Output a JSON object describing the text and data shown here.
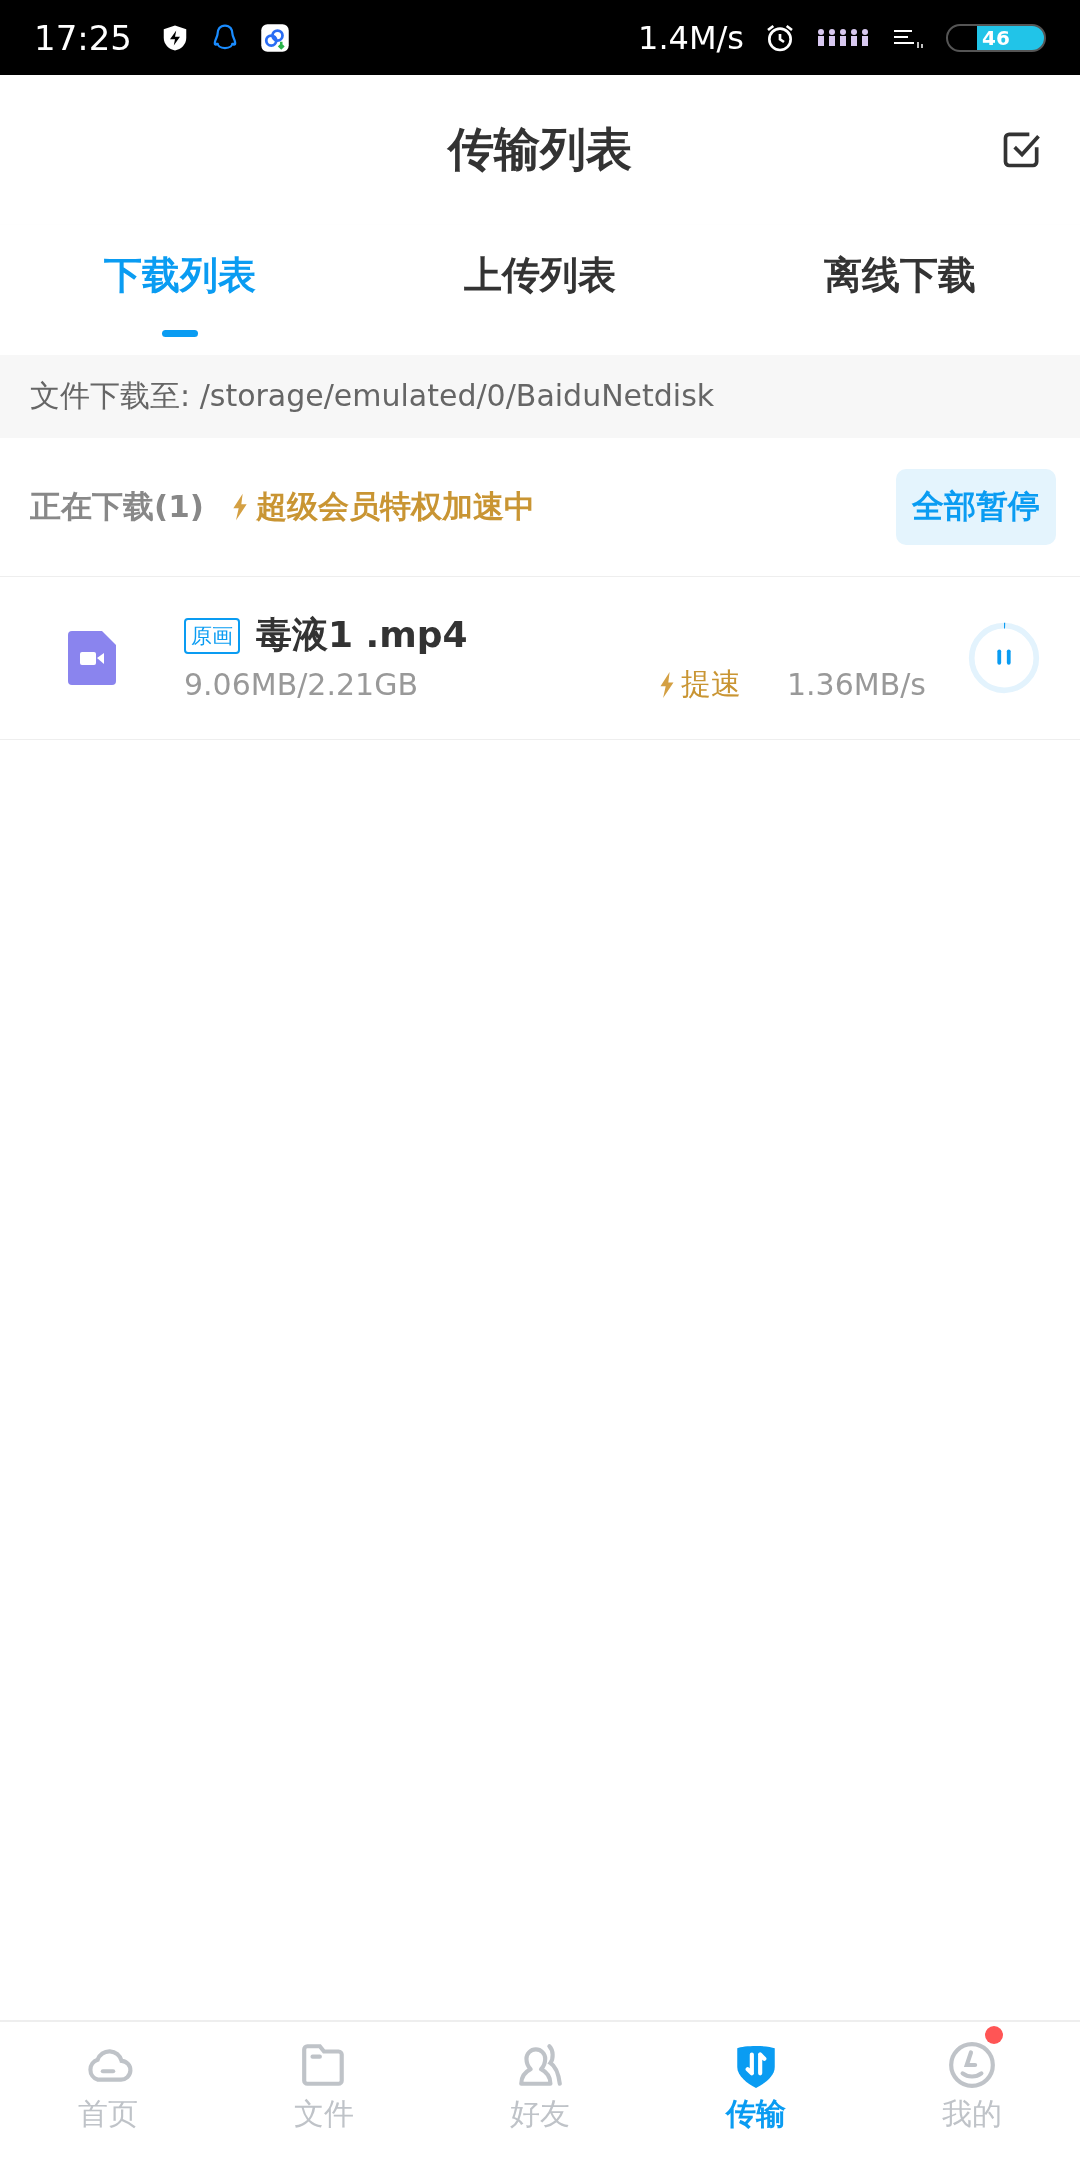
{
  "status_bar": {
    "time": "17:25",
    "net_speed": "1.4M/s",
    "battery": "46"
  },
  "header": {
    "title": "传输列表"
  },
  "tabs": [
    {
      "label": "下载列表",
      "selected": true
    },
    {
      "label": "上传列表",
      "selected": false
    },
    {
      "label": "离线下载",
      "selected": false
    }
  ],
  "path_bar": {
    "text": "文件下载至: /storage/emulated/0/BaiduNetdisk"
  },
  "section": {
    "title": "正在下载(1)",
    "boost_text": "超级会员特权加速中",
    "pause_all": "全部暂停"
  },
  "downloads": [
    {
      "tag": "原画",
      "name": "毒液1 .mp4",
      "size": "9.06MB/2.21GB",
      "boost": "提速",
      "speed": "1.36MB/s",
      "level": 0.004
    }
  ],
  "bottom_nav": [
    {
      "kind": "home",
      "label": "首页",
      "selected": false,
      "badge": false
    },
    {
      "kind": "files",
      "label": "文件",
      "selected": false,
      "badge": false
    },
    {
      "kind": "friends",
      "label": "好友",
      "selected": false,
      "badge": false
    },
    {
      "kind": "transfer",
      "label": "传输",
      "selected": true,
      "badge": false
    },
    {
      "kind": "me",
      "label": "我的",
      "selected": false,
      "badge": true
    }
  ]
}
